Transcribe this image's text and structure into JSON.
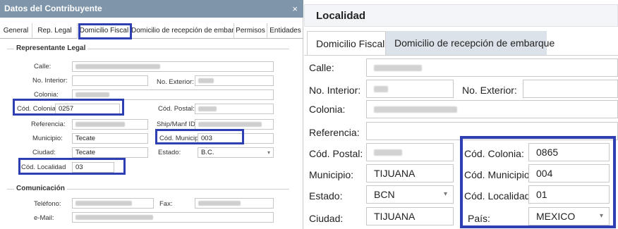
{
  "left": {
    "title": "Datos del Contribuyente",
    "close": "×",
    "tabs": [
      "General",
      "Rep. Legal",
      "Domicilio Fiscal",
      "Domicilio de recepción de embarque",
      "Permisos",
      "Entidades"
    ],
    "active_tab": "Domicilio Fiscal",
    "group_rep": "Representante Legal",
    "group_com": "Comunicación",
    "labels": {
      "calle": "Calle:",
      "no_interior": "No. Interior:",
      "no_exterior": "No. Exterior:",
      "colonia": "Colonia:",
      "cod_colonia": "Cód. Colonia:",
      "cod_postal": "Cód. Postal:",
      "referencia": "Referencia:",
      "ship_manf": "Ship/Manf ID:",
      "municipio": "Municipio:",
      "cod_municipio": "Cód. Municipio",
      "ciudad": "Ciudad:",
      "estado": "Estado:",
      "cod_localidad": "Cód. Localidad",
      "telefono": "Teléfono:",
      "fax": "Fax:",
      "email": "e-Mail:"
    },
    "values": {
      "cod_colonia": "0257",
      "municipio": "Tecate",
      "cod_municipio": "003",
      "ciudad": "Tecate",
      "estado": "B.C.",
      "cod_localidad": "03"
    }
  },
  "right": {
    "title": "Localidad",
    "tabs": [
      "Domicilio Fiscal",
      "Domicilio de recepción de embarque"
    ],
    "labels": {
      "calle": "Calle:",
      "no_interior": "No. Interior:",
      "no_exterior": "No. Exterior:",
      "colonia": "Colonia:",
      "referencia": "Referencia:",
      "cod_postal": "Cód. Postal:",
      "cod_colonia": "Cód. Colonia:",
      "municipio": "Municipio:",
      "cod_municipio": "Cód. Municipio",
      "estado": "Estado:",
      "cod_localidad": "Cód. Localidad:",
      "ciudad": "Ciudad:",
      "pais": "País:"
    },
    "values": {
      "cod_colonia": "0865",
      "municipio": "TIJUANA",
      "cod_municipio": "004",
      "estado": "BCN",
      "cod_localidad": "01",
      "ciudad": "TIJUANA",
      "pais": "MEXICO"
    }
  },
  "colors": {
    "highlight": "#2e3fb4",
    "titlebar": "#7f95a9",
    "inactive_tab": "#dce2ea"
  }
}
